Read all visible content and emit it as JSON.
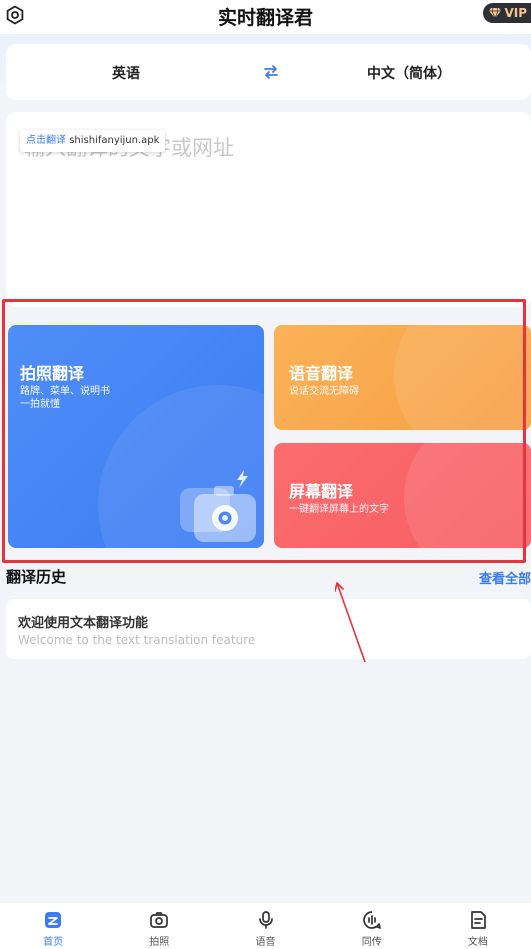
{
  "header": {
    "title": "实时翻译君",
    "vip_label": "VIP",
    "settings_icon": "gear-icon",
    "vip_icon": "diamond-icon"
  },
  "language_bar": {
    "source": "英语",
    "target": "中文（简体）",
    "swap_icon": "swap-arrows-icon"
  },
  "input": {
    "placeholder": "输入翻译的文字或网址",
    "download_tag_action": "点击翻译",
    "download_tag_file": "shishifanyijun.apk"
  },
  "features": [
    {
      "title": "拍照翻译",
      "subtitle_line1": "路牌、菜单、说明书",
      "subtitle_line2": "一拍就懂",
      "icon": "camera-icon",
      "color": "#4a87f5"
    },
    {
      "title": "语音翻译",
      "subtitle": "说话交流无障碍",
      "color": "#f9a84f"
    },
    {
      "title": "屏幕翻译",
      "subtitle": "一键翻译屏幕上的文字",
      "color": "#f86468"
    }
  ],
  "history": {
    "title": "翻译历史",
    "view_all": "查看全部",
    "items": [
      {
        "text": "欢迎使用文本翻译功能",
        "translation": "Welcome to the text translation feature"
      }
    ]
  },
  "bottom_nav": [
    {
      "label": "首页",
      "icon": "home-icon",
      "active": true
    },
    {
      "label": "拍照",
      "icon": "camera-icon",
      "active": false
    },
    {
      "label": "语音",
      "icon": "microphone-icon",
      "active": false
    },
    {
      "label": "同传",
      "icon": "simultaneous-icon",
      "active": false
    },
    {
      "label": "文档",
      "icon": "document-icon",
      "active": false
    }
  ],
  "colors": {
    "accent": "#3b7bf5",
    "annotation": "#e8323c",
    "background": "#f2f4f8"
  }
}
